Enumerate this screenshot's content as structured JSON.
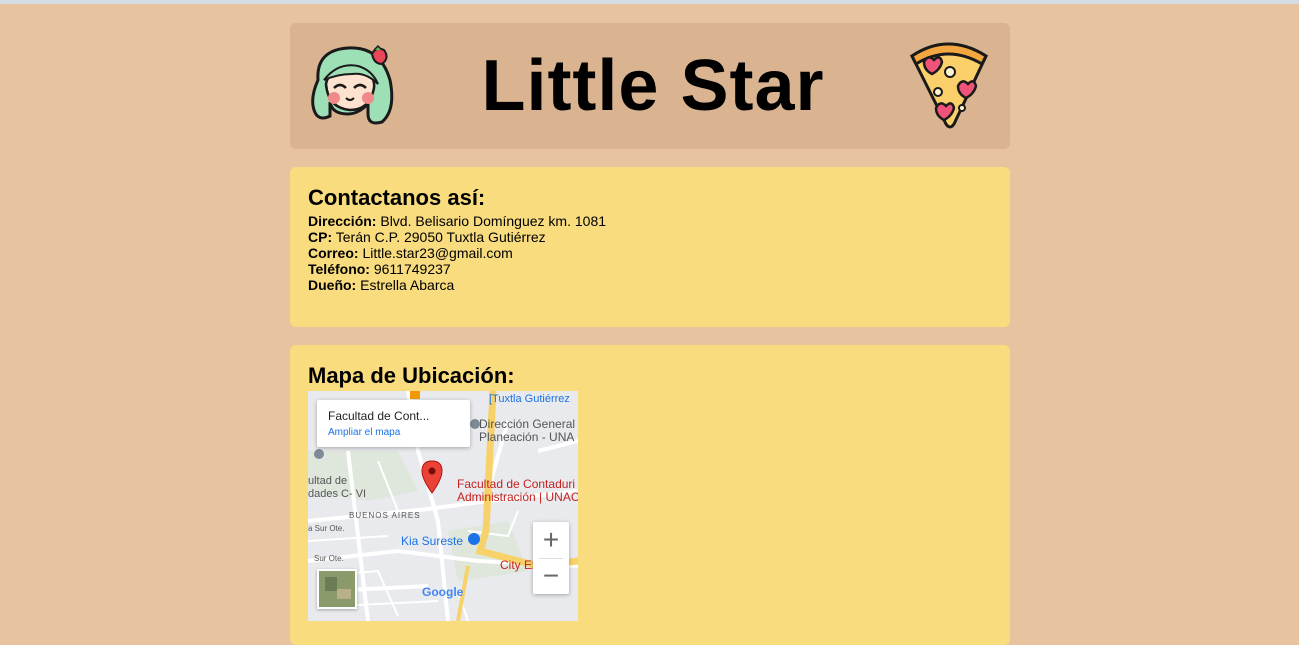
{
  "header": {
    "title": "Little Star"
  },
  "contact": {
    "heading": "Contactanos así:",
    "rows": [
      {
        "label": "Dirección:",
        "value": "Blvd. Belisario Domínguez km. 1081"
      },
      {
        "label": "CP:",
        "value": "Terán C.P. 29050 Tuxtla Gutiérrez"
      },
      {
        "label": "Correo:",
        "value": "Little.star23@gmail.com"
      },
      {
        "label": "Teléfono:",
        "value": "9611749237"
      },
      {
        "label": "Dueño:",
        "value": "Estrella Abarca"
      }
    ]
  },
  "map": {
    "heading": "Mapa de Ubicación:",
    "info_title": "Facultad de Cont...",
    "info_link": "Ampliar el mapa",
    "zoom_in": "+",
    "zoom_out": "−",
    "labels": {
      "tuxtla": "[Tuxtla Gutiérrez",
      "direccion1": "Dirección General",
      "direccion2": "Planeación - UNA",
      "facultad1": "Facultad de Contaduri",
      "facultad2": "Administración | UNAC",
      "ultad1": "ultad de",
      "ultad2": "dades C- VI",
      "buenos": "BUENOS AIRES",
      "sur1": "a Sur Ote.",
      "sur2": "Sur Ote.",
      "kia": "Kia Sureste",
      "city": "City Ex",
      "google": "Google"
    },
    "colors": {
      "pin": "#ea4335",
      "road": "#f7d26a",
      "label_blue": "#1a73e8",
      "label_red": "#c5221f"
    }
  }
}
